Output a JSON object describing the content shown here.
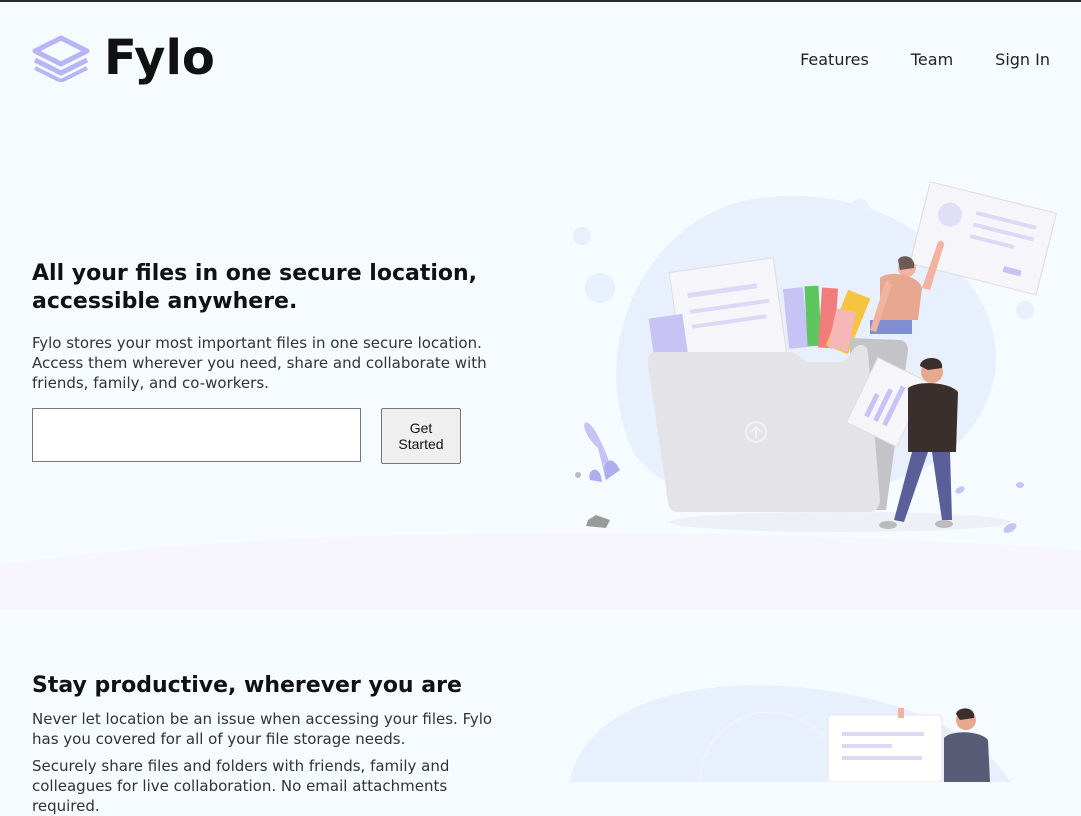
{
  "brand": {
    "name": "Fylo",
    "logo_icon": "layers-logo-icon",
    "accent": "#b9b4f5"
  },
  "nav": {
    "items": [
      {
        "label": "Features"
      },
      {
        "label": "Team"
      },
      {
        "label": "Sign In"
      }
    ]
  },
  "hero": {
    "title": "All your files in one secure location, accessible anywhere.",
    "text": "Fylo stores your most important files in one secure location. Access them wherever you need, share and collaborate with friends, family, and co-workers.",
    "email_value": "",
    "email_placeholder": "",
    "cta_label": "Get Started",
    "illustration": "files-folder-illustration"
  },
  "section2": {
    "title": "Stay productive, wherever you are",
    "text1": "Never let location be an issue when accessing your files. Fylo has you covered for all of your file storage needs.",
    "text2": "Securely share files and folders with friends, family and colleagues for live collaboration. No email attachments required.",
    "illustration": "person-with-document-illustration"
  },
  "colors": {
    "background": "#f5fbff",
    "blob": "#e8f0fe",
    "band": "#f7f6fc"
  }
}
